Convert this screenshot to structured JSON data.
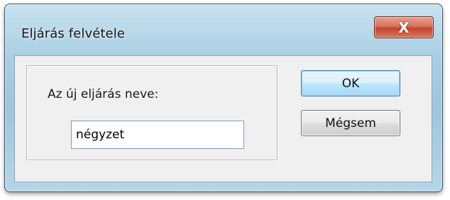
{
  "window": {
    "title": "Eljárás felvétele",
    "close_glyph": "X",
    "close_icon": "close-icon"
  },
  "form": {
    "label": "Az új eljárás neve:",
    "name_value": "négyzet"
  },
  "buttons": {
    "ok_label": "OK",
    "cancel_label": "Mégsem"
  },
  "colors": {
    "frame": "#a9cfe3",
    "close_button": "#c4432b",
    "client_bg": "#f0f0f0",
    "ok_border": "#3c7fb1"
  }
}
